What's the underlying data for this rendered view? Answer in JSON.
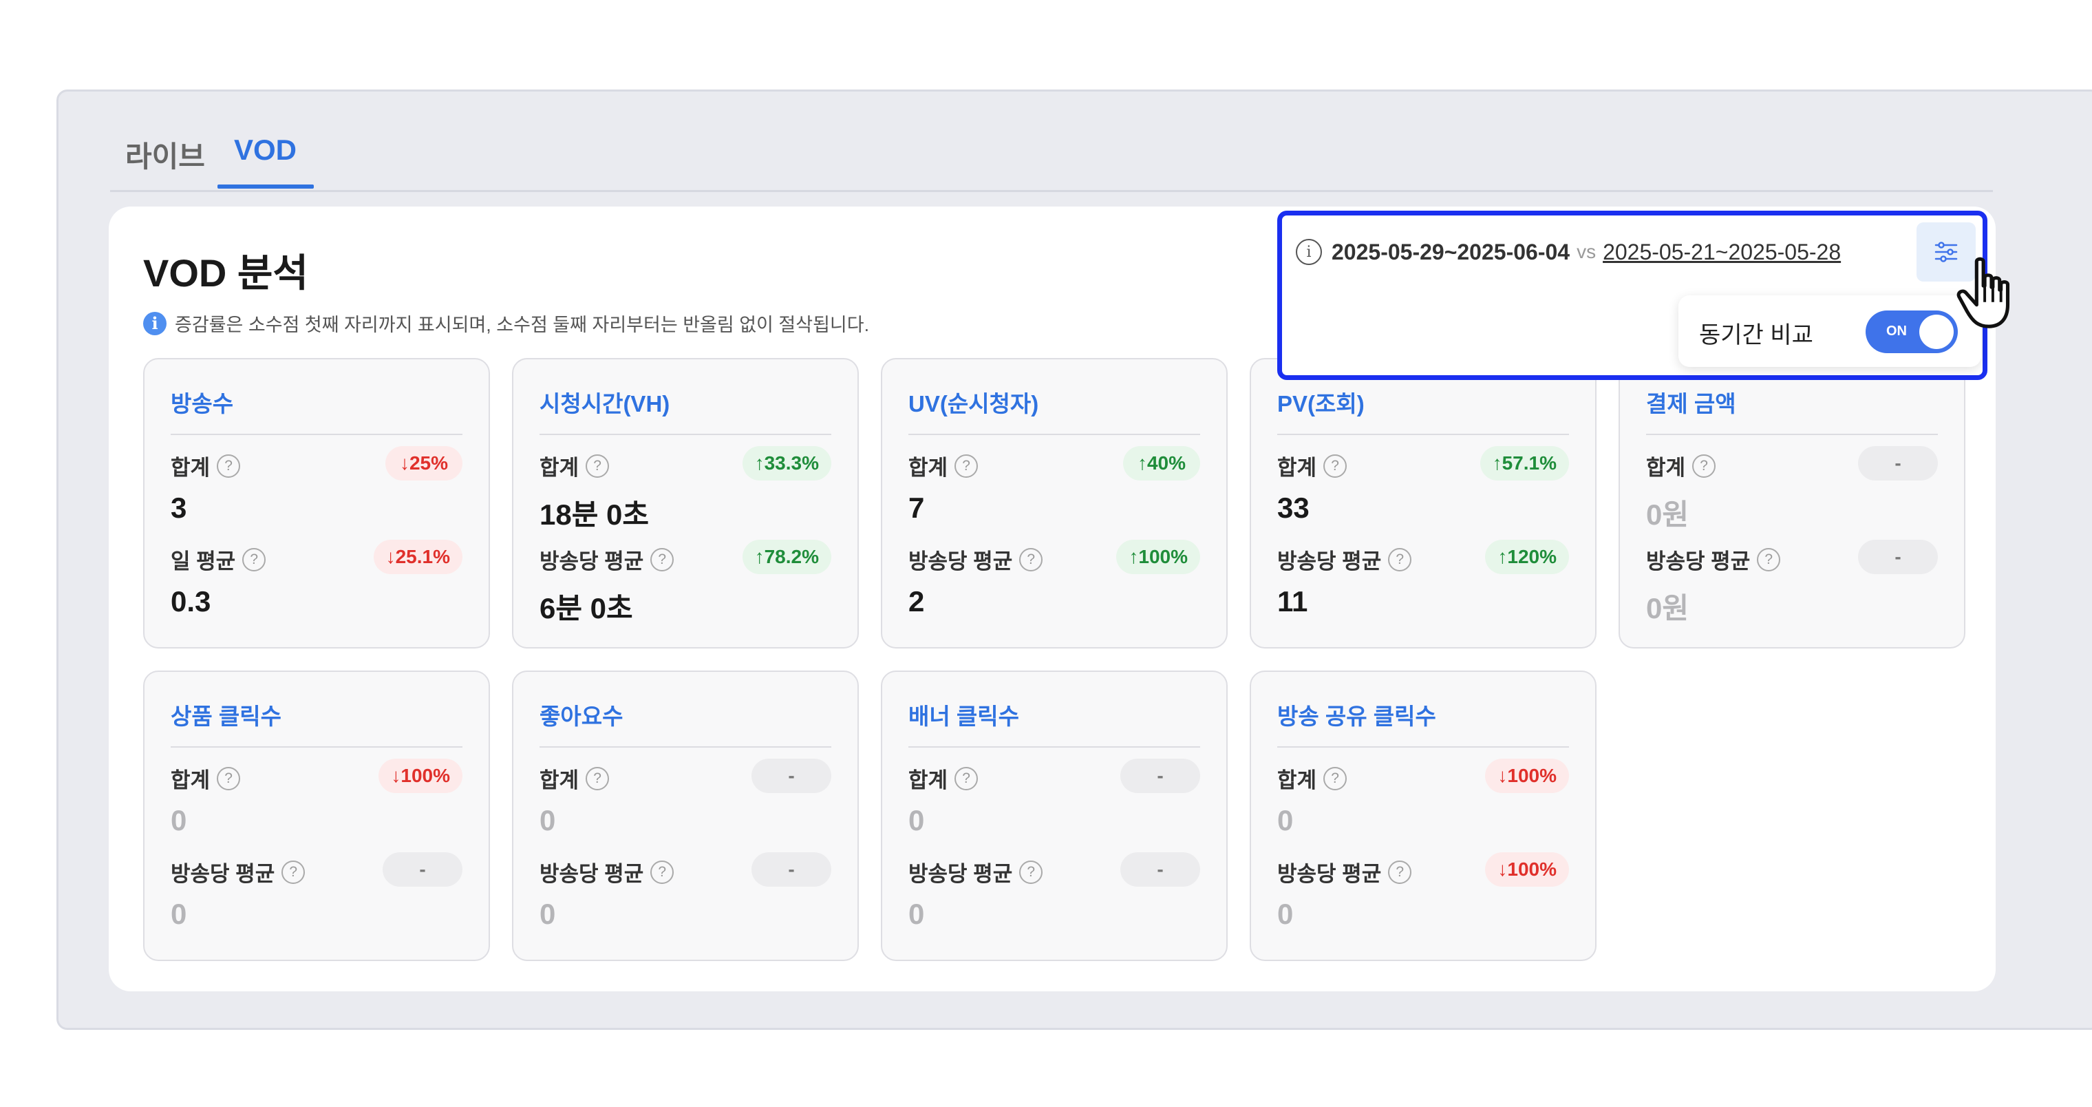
{
  "tabs": [
    {
      "label": "라이브",
      "active": false
    },
    {
      "label": "VOD",
      "active": true
    }
  ],
  "panel": {
    "title": "VOD 분석",
    "notice": "증감률은 소수점 첫째 자리까지 표시되며, 소수점 둘째 자리부터는 반올림 없이 절삭됩니다."
  },
  "date_filter": {
    "current_range": "2025-05-29~2025-06-04",
    "vs_label": "vs",
    "compare_range": "2025-05-21~2025-05-28",
    "compare_toggle_label": "동기간 비교",
    "toggle_state": "ON"
  },
  "cards": [
    {
      "title": "방송수",
      "r1_label": "합계",
      "r1_badge": "↓25%",
      "r1_value": "3",
      "r2_label": "일 평균",
      "r2_badge": "↓25.1%",
      "r2_value": "0.3"
    },
    {
      "title": "시청시간(VH)",
      "r1_label": "합계",
      "r1_badge": "↑33.3%",
      "r1_value": "18분 0초",
      "r2_label": "방송당 평균",
      "r2_badge": "↑78.2%",
      "r2_value": "6분 0초"
    },
    {
      "title": "UV(순시청자)",
      "r1_label": "합계",
      "r1_badge": "↑40%",
      "r1_value": "7",
      "r2_label": "방송당 평균",
      "r2_badge": "↑100%",
      "r2_value": "2"
    },
    {
      "title": "PV(조회)",
      "r1_label": "합계",
      "r1_badge": "↑57.1%",
      "r1_value": "33",
      "r2_label": "방송당 평균",
      "r2_badge": "↑120%",
      "r2_value": "11"
    },
    {
      "title": "결제 금액",
      "r1_label": "합계",
      "r1_badge": "-",
      "r1_value": "0원",
      "r2_label": "방송당 평균",
      "r2_badge": "-",
      "r2_value": "0원"
    },
    {
      "title": "상품 클릭수",
      "r1_label": "합계",
      "r1_badge": "↓100%",
      "r1_value": "0",
      "r2_label": "방송당 평균",
      "r2_badge": "-",
      "r2_value": "0"
    },
    {
      "title": "좋아요수",
      "r1_label": "합계",
      "r1_badge": "-",
      "r1_value": "0",
      "r2_label": "방송당 평균",
      "r2_badge": "-",
      "r2_value": "0"
    },
    {
      "title": "배너 클릭수",
      "r1_label": "합계",
      "r1_badge": "-",
      "r1_value": "0",
      "r2_label": "방송당 평균",
      "r2_badge": "-",
      "r2_value": "0"
    },
    {
      "title": "방송 공유 클릭수",
      "r1_label": "합계",
      "r1_badge": "↓100%",
      "r1_value": "0",
      "r2_label": "방송당 평균",
      "r2_badge": "↓100%",
      "r2_value": "0"
    }
  ],
  "icons": {
    "help": "question-icon",
    "info": "info-icon",
    "filter": "sliders-icon",
    "cursor": "hand-pointer-icon"
  },
  "colors": {
    "accent": "#2f72e0",
    "down": "#e0302b",
    "up": "#1f8d3a",
    "highlight_border": "#1a2ff0",
    "toggle_on": "#3f73ea"
  }
}
